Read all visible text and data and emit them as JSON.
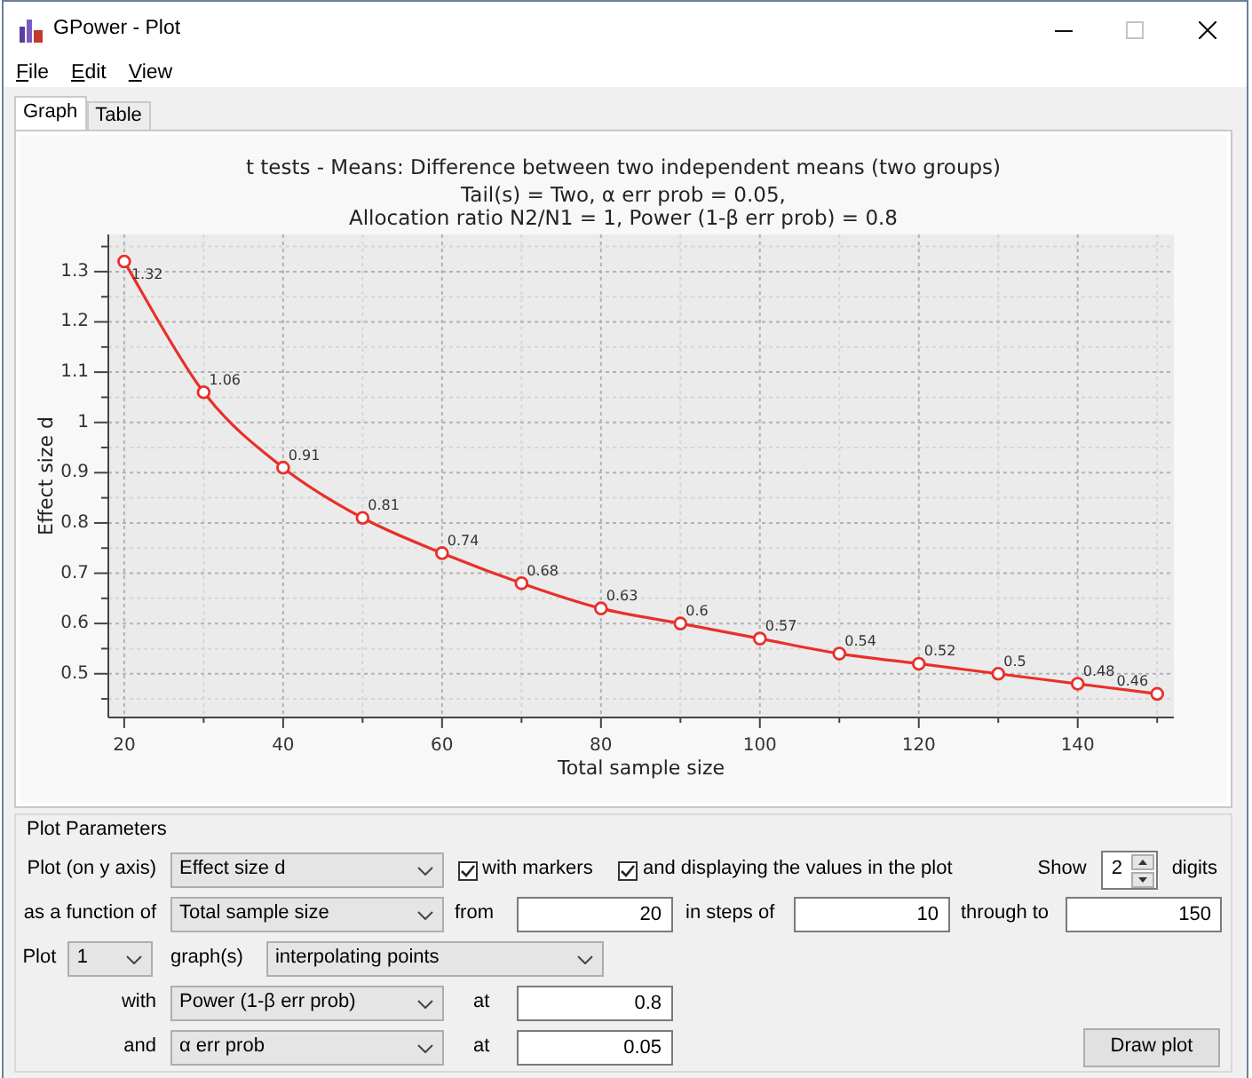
{
  "window": {
    "title": "GPower - Plot",
    "controls": [
      {
        "kind": "minimize",
        "disabled": false
      },
      {
        "kind": "maximize",
        "disabled": true
      },
      {
        "kind": "close",
        "disabled": false
      }
    ]
  },
  "menu": [
    {
      "label": "File"
    },
    {
      "label": "Edit"
    },
    {
      "label": "View"
    }
  ],
  "tabs": [
    {
      "label": "Graph",
      "selected": true
    },
    {
      "label": "Table",
      "selected": false
    }
  ],
  "graph": {
    "subtitle_lines": [
      "Tail(s) = Two, α err prob = 0.05,",
      "Allocation ratio N2/N1 = 1, Power (1-β err prob) = 0.8"
    ],
    "chart_data": {
      "type": "line",
      "title": "t tests - Means: Difference between two independent means (two groups)",
      "xlabel": "Total sample size",
      "ylabel": "Effect size d",
      "x": [
        20,
        30,
        40,
        50,
        60,
        70,
        80,
        90,
        100,
        110,
        120,
        130,
        140,
        150
      ],
      "series": [
        {
          "color": "#e8302a",
          "marker": "circle",
          "values": [
            1.32,
            1.06,
            0.91,
            0.81,
            0.74,
            0.68,
            0.63,
            0.6,
            0.57,
            0.54,
            0.52,
            0.5,
            0.48,
            0.46
          ]
        }
      ],
      "xlim": [
        18,
        152.1
      ],
      "ylim": [
        0.413,
        1.374
      ],
      "xticks": [
        20,
        40,
        60,
        80,
        100,
        120,
        140
      ],
      "yticks": [
        0.5,
        0.6,
        0.7,
        0.8,
        0.9,
        1,
        1.1,
        1.2,
        1.3
      ],
      "grid": true,
      "data_labels": true
    }
  },
  "plot_parameters": {
    "title": "Plot Parameters",
    "y_axis": {
      "label": "Plot (on y axis)",
      "value": "Effect size d"
    },
    "with_markers": {
      "label": "with markers",
      "checked": true
    },
    "display_values": {
      "label": "and displaying the values in the plot",
      "checked": true
    },
    "digits": {
      "label": "Show",
      "value": "2",
      "unit": "digits"
    },
    "x_axis": {
      "label": "as a function of",
      "value": "Total sample size"
    },
    "range": {
      "from_label": "from",
      "from": "20",
      "step_label": "in steps of",
      "step": "10",
      "to_label": "through to",
      "to": "150"
    },
    "graphs": {
      "label": "Plot",
      "count": "1",
      "unit": "graph(s)",
      "mode": "interpolating points"
    },
    "fixed": [
      {
        "label": "with",
        "parameter": "Power (1-β err prob)",
        "at_label": "at",
        "value": "0.8"
      },
      {
        "label": "and",
        "parameter": "α err prob",
        "at_label": "at",
        "value": "0.05"
      }
    ],
    "draw_button": "Draw plot"
  }
}
